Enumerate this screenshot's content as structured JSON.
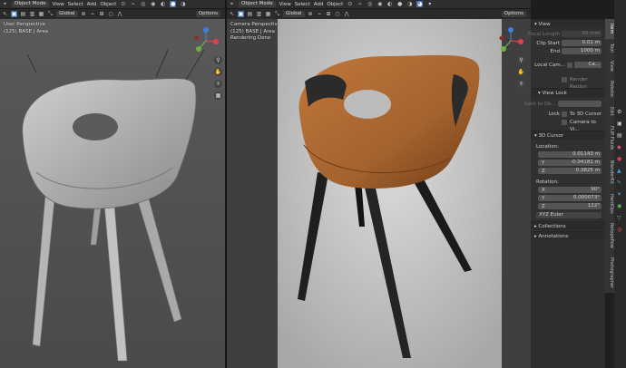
{
  "left_view": {
    "mode": "Object Mode",
    "menus": [
      "View",
      "Select",
      "Add",
      "Object"
    ],
    "orientation": "Global",
    "options": "Options",
    "overlay_lines": [
      "User Perspective",
      "(125) BASE | Area"
    ]
  },
  "right_view": {
    "mode": "Object Mode",
    "menus": [
      "View",
      "Select",
      "Add",
      "Object"
    ],
    "orientation": "Global",
    "options": "Options",
    "overlay_lines": [
      "Camera Perspective",
      "(125) BASE | Area",
      "Rendering Done"
    ]
  },
  "panel": {
    "view_section": "View",
    "focal_length_label": "Focal Length",
    "focal_length_value": "50 mm",
    "clip_start_label": "Clip Start",
    "clip_start_value": "0.01 m",
    "clip_end_label": "End",
    "clip_end_value": "1000 m",
    "local_camera_label": "Local Cam...",
    "local_camera_value": "Ca...",
    "render_region_label": "Render Region",
    "view_lock_section": "View Lock",
    "lock_to_object_label": "Lock to Ob...",
    "lock_label": "Lock",
    "to_3d_cursor_label": "To 3D Cursor",
    "camera_to_view_label": "Camera to Vi...",
    "cursor_section": "3D Cursor",
    "location_label": "Location:",
    "loc_x": "0.01143 m",
    "loc_y": "-0.04181 m",
    "loc_z": "0.3825 m",
    "rotation_label": "Rotation:",
    "rot_x": "90°",
    "rot_y": "0.000073°",
    "rot_z": "122°",
    "rotation_mode": "XYZ Euler",
    "collections_section": "Collections",
    "annotations_section": "Annotations",
    "axis_x": "X",
    "axis_y": "Y",
    "axis_z": "Z"
  },
  "tabs": [
    "Item",
    "Tool",
    "View",
    "Rokoko",
    "Edit",
    "FLIP Fluids",
    "BlenderKit",
    "HardOps",
    "Retopoflow",
    "Photographer"
  ],
  "colors": {
    "accent": "#4772b3",
    "leather": "#a4622e",
    "gizmo_x": "#e0424c",
    "gizmo_y": "#6fb13c",
    "gizmo_z": "#3f7fdc"
  }
}
